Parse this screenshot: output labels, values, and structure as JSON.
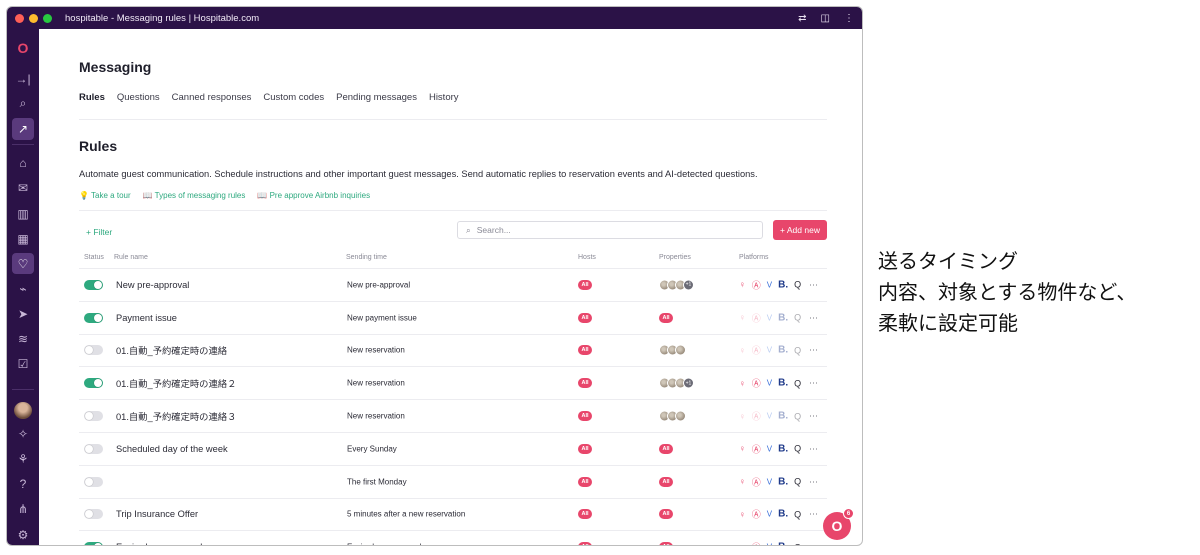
{
  "window": {
    "title": "hospitable - Messaging rules | Hospitable.com",
    "traffic_lights": [
      "#ff5f57",
      "#febc2e",
      "#28c840"
    ]
  },
  "sidebar": {
    "icons": [
      "hospitable-logo-icon",
      "expand-icon",
      "search-icon",
      "trending-icon",
      "home-icon",
      "mail-icon",
      "building-icon",
      "calendar-icon",
      "heart-icon",
      "chart-icon",
      "send-icon",
      "wifi-icon",
      "checkbox-icon"
    ],
    "active": "heart-icon",
    "bottom_icons": [
      "sparkle-icon",
      "gift-icon",
      "help-icon",
      "org-icon",
      "settings-icon"
    ]
  },
  "page": {
    "title": "Messaging",
    "tabs": [
      "Rules",
      "Questions",
      "Canned responses",
      "Custom codes",
      "Pending messages",
      "History"
    ],
    "active_tab": "Rules"
  },
  "rules_section": {
    "title": "Rules",
    "description": "Automate guest communication. Schedule instructions and other important guest messages. Send automatic replies to reservation events and AI-detected questions.",
    "links": [
      "Take a tour",
      "Types of messaging rules",
      "Pre approve Airbnb inquiries"
    ],
    "filter_label": "+ Filter",
    "search_placeholder": "Search...",
    "add_button": "+ Add new"
  },
  "table": {
    "headers": [
      "Status",
      "Rule name",
      "Sending time",
      "Hosts",
      "Properties",
      "Platforms"
    ],
    "rows": [
      {
        "enabled": true,
        "name": "New pre-approval",
        "time": "New pre-approval",
        "hosts": "All",
        "properties": "avatars",
        "more": "+1",
        "platforms_faded": false
      },
      {
        "enabled": true,
        "name": "Payment issue",
        "time": "New payment issue",
        "hosts": "All",
        "properties": "All",
        "platforms_faded": true
      },
      {
        "enabled": false,
        "name": "01.自動_予約確定時の連絡",
        "time": "New reservation",
        "hosts": "All",
        "properties": "avatars",
        "platforms_faded": true
      },
      {
        "enabled": true,
        "name": "01.自動_予約確定時の連絡２",
        "time": "New reservation",
        "hosts": "All",
        "properties": "avatars",
        "more": "+1",
        "platforms_faded": false
      },
      {
        "enabled": false,
        "name": "01.自動_予約確定時の連絡３",
        "time": "New reservation",
        "hosts": "All",
        "properties": "avatars",
        "platforms_faded": true
      },
      {
        "enabled": false,
        "name": "Scheduled day of the week",
        "time": "Every Sunday",
        "hosts": "All",
        "properties": "All",
        "platforms_faded": false
      },
      {
        "enabled": false,
        "name": "",
        "time": "The first Monday",
        "hosts": "All",
        "properties": "All",
        "platforms_faded": false
      },
      {
        "enabled": false,
        "name": "Trip Insurance Offer",
        "time": "5 minutes after a new reservation",
        "hosts": "All",
        "properties": "All",
        "platforms_faded": false
      },
      {
        "enabled": true,
        "name": "Expired pre-approval",
        "time": "Expired pre-approval",
        "hosts": "All",
        "properties": "All",
        "platforms_faded": false
      }
    ]
  },
  "fab": {
    "badge": "6"
  },
  "annotation": {
    "lines": [
      "送るタイミング",
      "内容、対象とする物件など、",
      "柔軟に設定可能"
    ]
  },
  "colors": {
    "sidebar": "#2b1247",
    "accent": "#e8466b",
    "link": "#2ea97f"
  }
}
